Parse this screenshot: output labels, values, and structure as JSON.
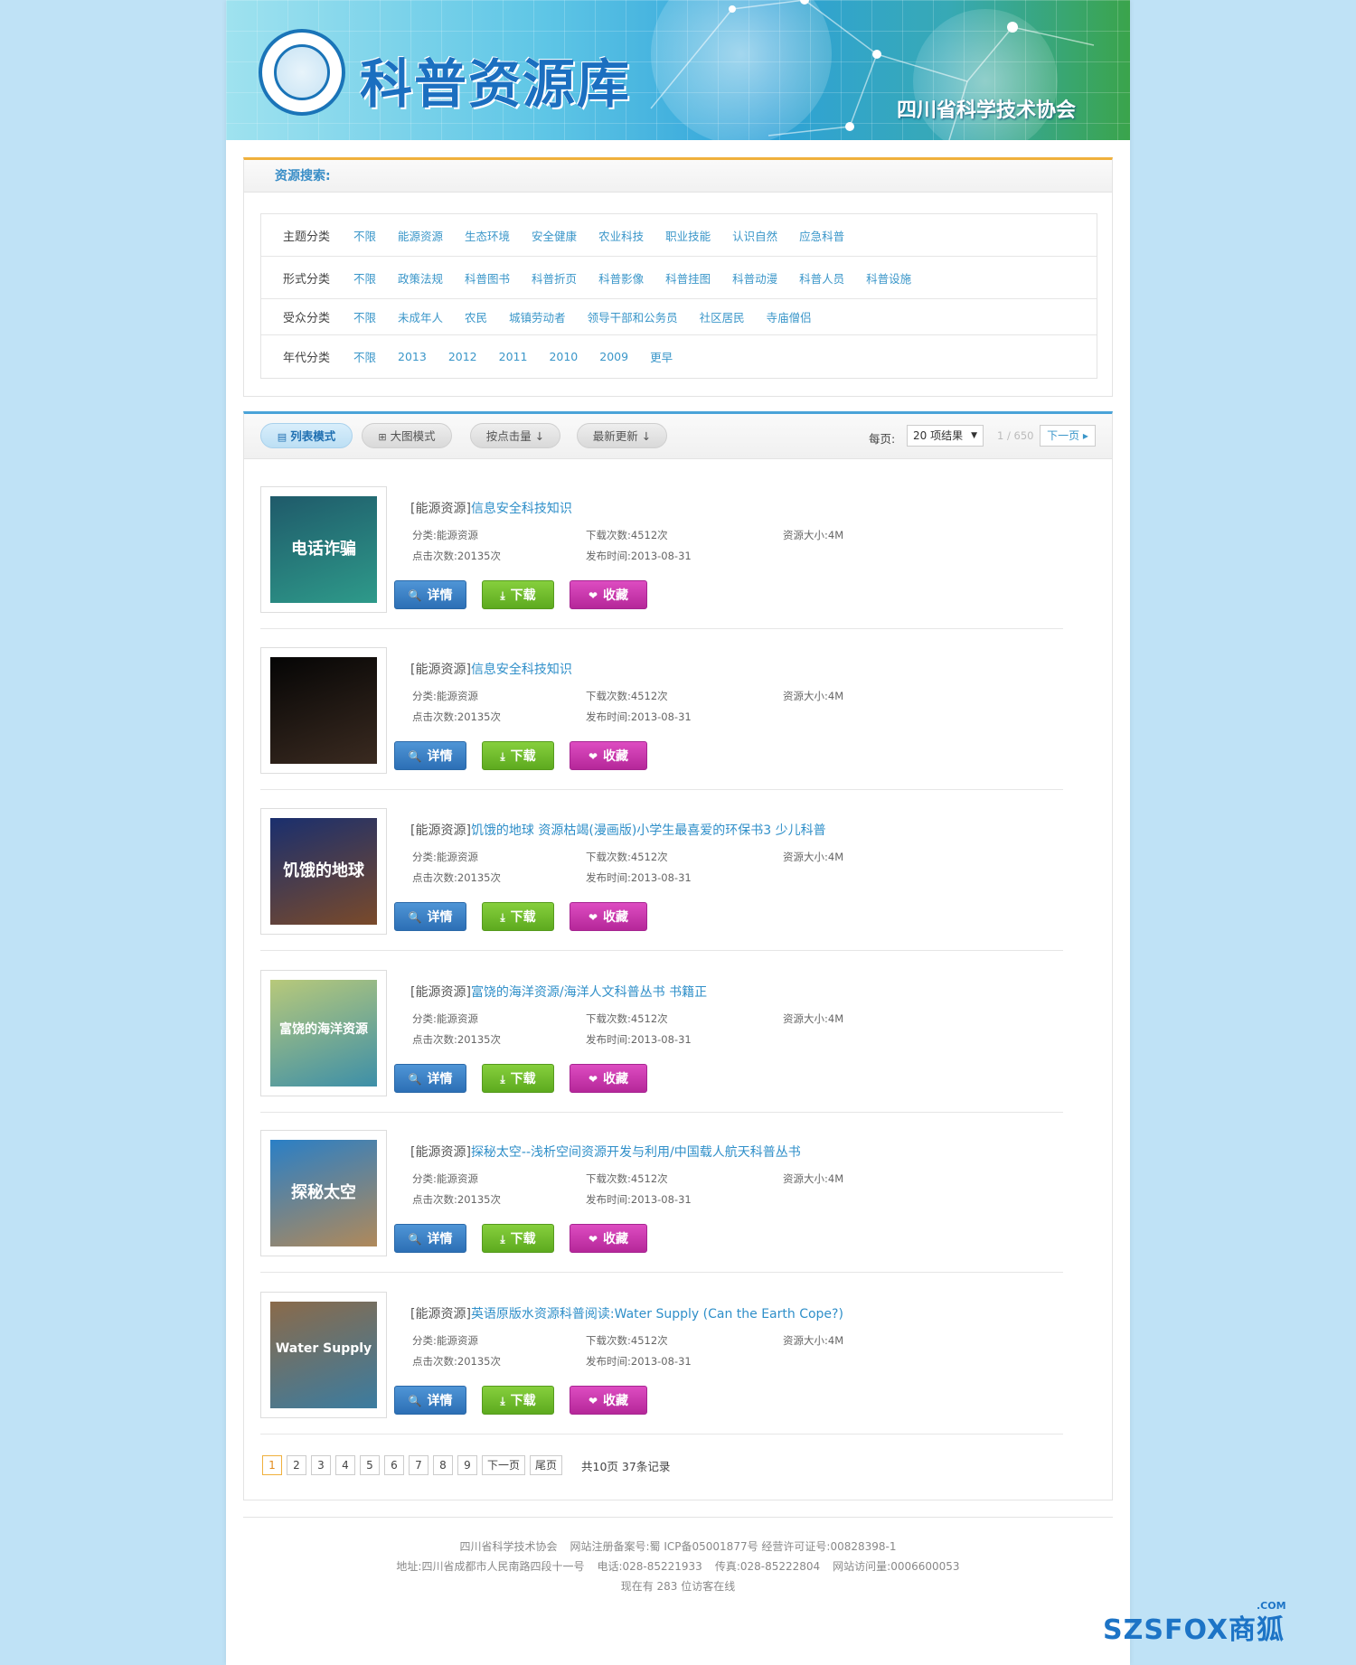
{
  "banner": {
    "title": "科普资源库",
    "org": "四川省科学技术协会"
  },
  "search": {
    "heading": "资源搜索:",
    "rows": [
      {
        "label": "主题分类",
        "items": [
          "不限",
          "能源资源",
          "生态环境",
          "安全健康",
          "农业科技",
          "职业技能",
          "认识自然",
          "应急科普"
        ]
      },
      {
        "label": "形式分类",
        "items": [
          "不限",
          "政策法规",
          "科普图书",
          "科普折页",
          "科普影像",
          "科普挂图",
          "科普动漫",
          "科普人员",
          "科普设施"
        ]
      },
      {
        "label": "受众分类",
        "items": [
          "不限",
          "未成年人",
          "农民",
          "城镇劳动者",
          "领导干部和公务员",
          "社区居民",
          "寺庙僧侣"
        ]
      },
      {
        "label": "年代分类",
        "items": [
          "不限",
          "2013",
          "2012",
          "2011",
          "2010",
          "2009",
          "更早"
        ]
      }
    ]
  },
  "toolbar": {
    "list_mode": "列表模式",
    "grid_mode": "大图模式",
    "sort_clicks": "按点击量",
    "sort_latest": "最新更新",
    "per_page_label": "每页:",
    "per_page_value": "20 项结果",
    "page_counter": "1 / 650",
    "next_page": "下一页"
  },
  "item_labels": {
    "category_prefix": "分类:",
    "downloads_prefix": "下载次数:",
    "size_prefix": "资源大小:",
    "clicks_prefix": "点击次数:",
    "date_prefix": "发布时间:",
    "detail": "详情",
    "download": "下载",
    "favorite": "收藏"
  },
  "items": [
    {
      "category": "[能源资源]",
      "title": "信息安全科技知识",
      "cat_value": "能源资源",
      "downloads": "4512次",
      "size": "4M",
      "clicks": "20135次",
      "date": "2013-08-31",
      "thumb_text": "电话诈骗",
      "thumb_colors": [
        "#1f5a6a",
        "#2e9a8a"
      ]
    },
    {
      "category": "[能源资源]",
      "title": "信息安全科技知识",
      "cat_value": "能源资源",
      "downloads": "4512次",
      "size": "4M",
      "clicks": "20135次",
      "date": "2013-08-31",
      "thumb_text": "",
      "thumb_colors": [
        "#050505",
        "#3a2a20"
      ]
    },
    {
      "category": "[能源资源]",
      "title": "饥饿的地球 资源枯竭(漫画版)小学生最喜爱的环保书3 少儿科普",
      "cat_value": "能源资源",
      "downloads": "4512次",
      "size": "4M",
      "clicks": "20135次",
      "date": "2013-08-31",
      "thumb_text": "饥饿的地球",
      "thumb_colors": [
        "#1a2f6e",
        "#7a4a2a"
      ]
    },
    {
      "category": "[能源资源]",
      "title": "富饶的海洋资源/海洋人文科普丛书 书籍正",
      "cat_value": "能源资源",
      "downloads": "4512次",
      "size": "4M",
      "clicks": "20135次",
      "date": "2013-08-31",
      "thumb_text": "富饶的海洋资源",
      "thumb_colors": [
        "#b8c97a",
        "#3d8fa8"
      ]
    },
    {
      "category": "[能源资源]",
      "title": "探秘太空--浅析空间资源开发与利用/中国载人航天科普丛书",
      "cat_value": "能源资源",
      "downloads": "4512次",
      "size": "4M",
      "clicks": "20135次",
      "date": "2013-08-31",
      "thumb_text": "探秘太空",
      "thumb_colors": [
        "#2a7fc6",
        "#b0895a"
      ]
    },
    {
      "category": "[能源资源]",
      "title": "英语原版水资源科普阅读:Water Supply (Can the Earth Cope?)",
      "cat_value": "能源资源",
      "downloads": "4512次",
      "size": "4M",
      "clicks": "20135次",
      "date": "2013-08-31",
      "thumb_text": "Water Supply",
      "thumb_colors": [
        "#8a6a4a",
        "#3b7ca0"
      ]
    }
  ],
  "pager": {
    "pages": [
      "1",
      "2",
      "3",
      "4",
      "5",
      "6",
      "7",
      "8",
      "9"
    ],
    "next": "下一页",
    "last": "尾页",
    "summary": "共10页 37条记录"
  },
  "footer": {
    "line1_a": "四川省科学技术协会",
    "line1_b": "网站注册备案号:蜀 ICP备05001877号 经营许可证号:00828398-1",
    "line2_a": "地址:四川省成都市人民南路四段十一号",
    "line2_b": "电话:028-85221933",
    "line2_c": "传真:028-85222804",
    "line2_d": "网站访问量:0006600053",
    "line3": "现在有 283  位访客在线"
  },
  "watermark": {
    "text": "SZSFOX",
    "suffix": "商狐",
    "com": ".COM"
  }
}
